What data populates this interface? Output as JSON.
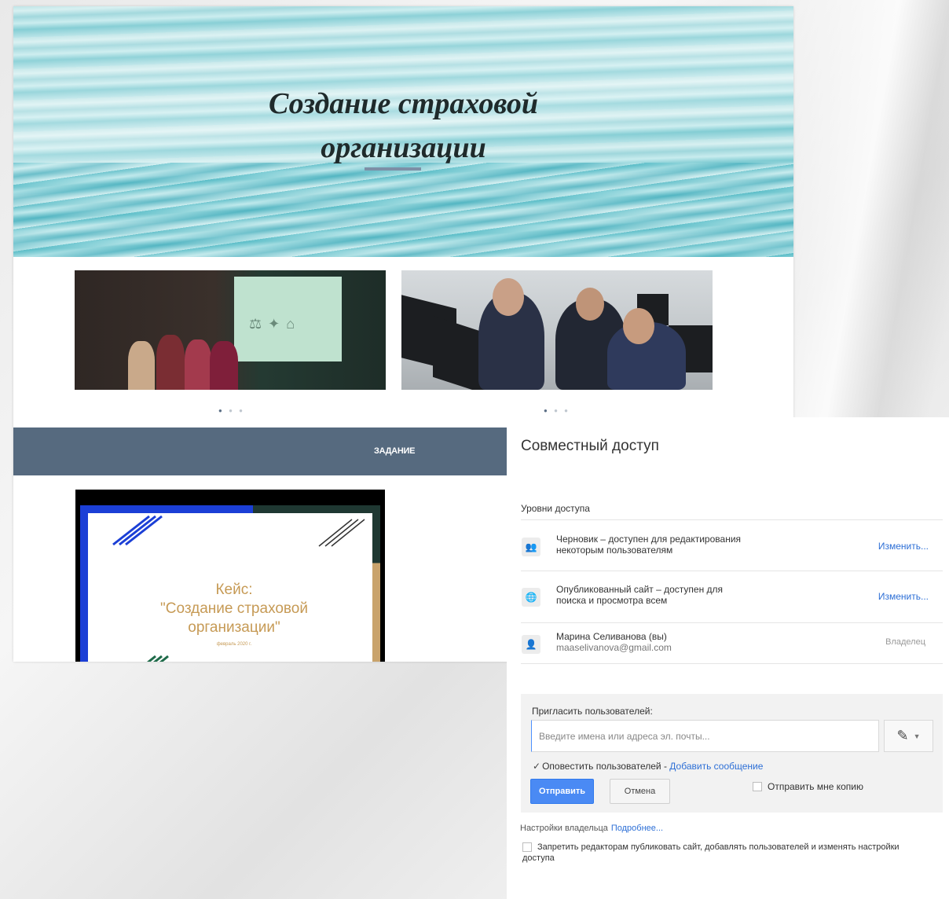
{
  "site": {
    "banner_title_line1": "Создание страховой",
    "banner_title_line2": "организации",
    "nav_item": "ЗАДАНИЕ",
    "slide": {
      "title_line1": "Кейс:",
      "title_line2": "\"Создание страховой",
      "title_line3": "организации\"",
      "date": "февраль 2020 г."
    },
    "dots": "● ● ●"
  },
  "dialog": {
    "title": "Совместный доступ",
    "levels_label": "Уровни доступа",
    "rows": [
      {
        "line1": "Черновик – доступен для редактирования",
        "line2": "некоторым пользователям",
        "action": "Изменить..."
      },
      {
        "line1": "Опубликованный сайт – доступен для",
        "line2": "поиска и просмотра всем",
        "action": "Изменить..."
      },
      {
        "line1": "Марина Селиванова (вы)",
        "line2": "maaselivanova@gmail.com",
        "action": "Владелец"
      }
    ],
    "invite": {
      "label": "Пригласить пользователей:",
      "placeholder": "Введите имена или адреса эл. почты...",
      "notify_label": "Оповестить пользователей - ",
      "add_message": "Добавить сообщение",
      "send": "Отправить",
      "cancel": "Отмена",
      "send_copy": "Отправить мне копию"
    },
    "owner_settings": "Настройки владельца",
    "more": "Подробнее...",
    "restrict_label": "Запретить редакторам публиковать сайт, добавлять пользователей и изменять настройки доступа"
  },
  "colors": {
    "navbar": "#566a7f",
    "link": "#2d6fd6",
    "primary_button": "#4a8af4",
    "slide_accent": "#c69a55"
  }
}
